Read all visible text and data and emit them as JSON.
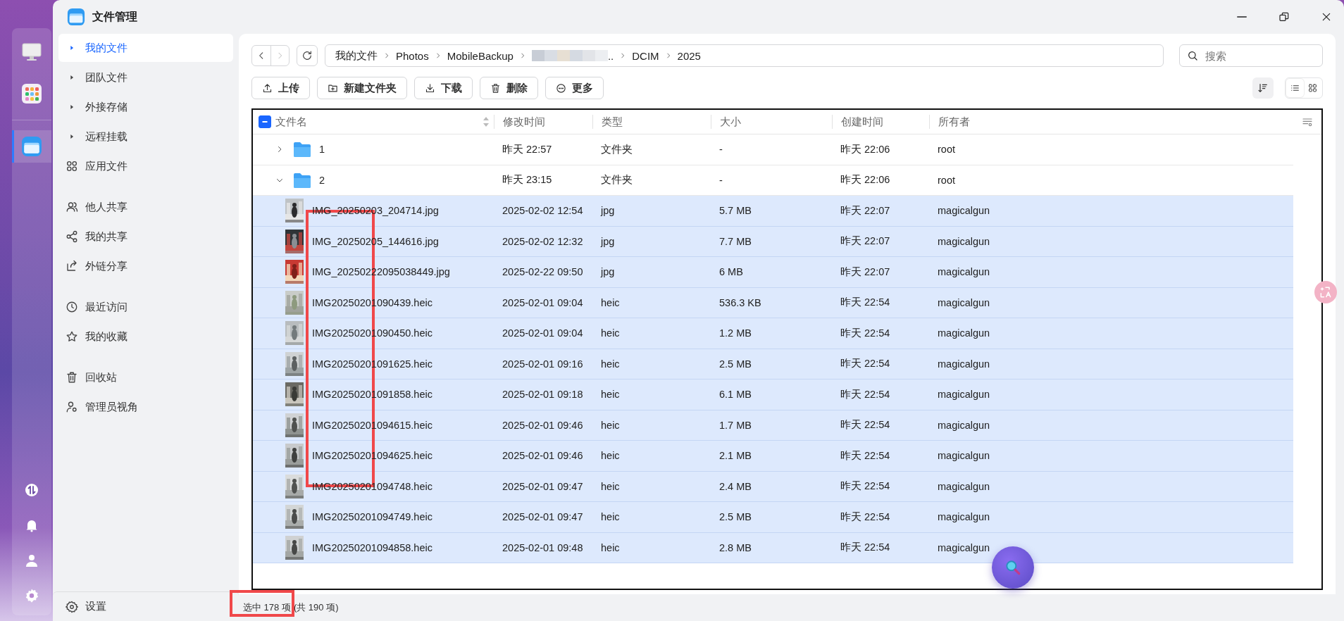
{
  "window": {
    "title": "文件管理"
  },
  "dock": [
    {
      "kind": "monitor",
      "selected": false
    },
    {
      "kind": "apps",
      "selected": false
    },
    {
      "kind": "files",
      "selected": true
    }
  ],
  "dock_bottom": [
    {
      "kind": "transfer"
    },
    {
      "kind": "bell"
    },
    {
      "kind": "user"
    },
    {
      "kind": "gear"
    }
  ],
  "sidebar": {
    "groups": [
      [
        {
          "label": "我的文件",
          "kind": "caret",
          "selected": true
        },
        {
          "label": "团队文件",
          "kind": "caret",
          "selected": false
        },
        {
          "label": "外接存储",
          "kind": "caret",
          "selected": false
        },
        {
          "label": "远程挂载",
          "kind": "caret",
          "selected": false
        },
        {
          "label": "应用文件",
          "kind": "apps",
          "selected": false
        }
      ],
      [
        {
          "label": "他人共享",
          "kind": "users",
          "selected": false
        },
        {
          "label": "我的共享",
          "kind": "share",
          "selected": false
        },
        {
          "label": "外链分享",
          "kind": "export",
          "selected": false
        }
      ],
      [
        {
          "label": "最近访问",
          "kind": "clock",
          "selected": false
        },
        {
          "label": "我的收藏",
          "kind": "star",
          "selected": false
        }
      ],
      [
        {
          "label": "回收站",
          "kind": "trash",
          "selected": false
        },
        {
          "label": "管理员视角",
          "kind": "admin",
          "selected": false
        }
      ]
    ],
    "settings": "设置"
  },
  "breadcrumb": [
    {
      "label": "我的文件",
      "kind": "text"
    },
    {
      "label": "Photos",
      "kind": "text"
    },
    {
      "label": "MobileBackup",
      "kind": "text"
    },
    {
      "label": "..",
      "kind": "blurred"
    },
    {
      "label": "DCIM",
      "kind": "text"
    },
    {
      "label": "2025",
      "kind": "text"
    }
  ],
  "search": {
    "placeholder": "搜索"
  },
  "toolbar": [
    {
      "label": "上传",
      "kind": "upload"
    },
    {
      "label": "新建文件夹",
      "kind": "folder"
    },
    {
      "label": "下载",
      "kind": "download"
    },
    {
      "label": "删除",
      "kind": "trash"
    },
    {
      "label": "更多",
      "kind": "more"
    }
  ],
  "view_mode": [
    {
      "kind": "list",
      "selected": true
    },
    {
      "kind": "grid",
      "selected": false
    }
  ],
  "table": {
    "select_all": {
      "partial": true
    },
    "columns": [
      "文件名",
      "修改时间",
      "类型",
      "大小",
      "创建时间",
      "所有者"
    ],
    "rows": [
      {
        "kind": "folder",
        "expanded": false,
        "selected": false,
        "name": "1",
        "modified": "昨天 22:57",
        "type": "文件夹",
        "size": "-",
        "created": "昨天 22:06",
        "owner": "root"
      },
      {
        "kind": "folder",
        "expanded": true,
        "selected": false,
        "name": "2",
        "modified": "昨天 23:15",
        "type": "文件夹",
        "size": "-",
        "created": "昨天 22:06",
        "owner": "root"
      },
      {
        "kind": "file",
        "selected": true,
        "name": "IMG_20250203_204714.jpg",
        "modified": "2025-02-02 12:54",
        "type": "jpg",
        "size": "5.7 MB",
        "created": "昨天 22:07",
        "owner": "magicalgun"
      },
      {
        "kind": "file",
        "selected": true,
        "name": "IMG_20250205_144616.jpg",
        "modified": "2025-02-02 12:32",
        "type": "jpg",
        "size": "7.7 MB",
        "created": "昨天 22:07",
        "owner": "magicalgun"
      },
      {
        "kind": "file",
        "selected": true,
        "name": "IMG_20250222095038449.jpg",
        "modified": "2025-02-22 09:50",
        "type": "jpg",
        "size": "6 MB",
        "created": "昨天 22:07",
        "owner": "magicalgun"
      },
      {
        "kind": "file",
        "selected": true,
        "name": "IMG20250201090439.heic",
        "modified": "2025-02-01 09:04",
        "type": "heic",
        "size": "536.3 KB",
        "created": "昨天 22:54",
        "owner": "magicalgun"
      },
      {
        "kind": "file",
        "selected": true,
        "name": "IMG20250201090450.heic",
        "modified": "2025-02-01 09:04",
        "type": "heic",
        "size": "1.2 MB",
        "created": "昨天 22:54",
        "owner": "magicalgun"
      },
      {
        "kind": "file",
        "selected": true,
        "name": "IMG20250201091625.heic",
        "modified": "2025-02-01 09:16",
        "type": "heic",
        "size": "2.5 MB",
        "created": "昨天 22:54",
        "owner": "magicalgun"
      },
      {
        "kind": "file",
        "selected": true,
        "name": "IMG20250201091858.heic",
        "modified": "2025-02-01 09:18",
        "type": "heic",
        "size": "6.1 MB",
        "created": "昨天 22:54",
        "owner": "magicalgun"
      },
      {
        "kind": "file",
        "selected": true,
        "name": "IMG20250201094615.heic",
        "modified": "2025-02-01 09:46",
        "type": "heic",
        "size": "1.7 MB",
        "created": "昨天 22:54",
        "owner": "magicalgun"
      },
      {
        "kind": "file",
        "selected": true,
        "name": "IMG20250201094625.heic",
        "modified": "2025-02-01 09:46",
        "type": "heic",
        "size": "2.1 MB",
        "created": "昨天 22:54",
        "owner": "magicalgun"
      },
      {
        "kind": "file",
        "selected": true,
        "name": "IMG20250201094748.heic",
        "modified": "2025-02-01 09:47",
        "type": "heic",
        "size": "2.4 MB",
        "created": "昨天 22:54",
        "owner": "magicalgun"
      },
      {
        "kind": "file",
        "selected": true,
        "name": "IMG20250201094749.heic",
        "modified": "2025-02-01 09:47",
        "type": "heic",
        "size": "2.5 MB",
        "created": "昨天 22:54",
        "owner": "magicalgun"
      },
      {
        "kind": "file",
        "selected": true,
        "name": "IMG20250201094858.heic",
        "modified": "2025-02-01 09:48",
        "type": "heic",
        "size": "2.8 MB",
        "created": "昨天 22:54",
        "owner": "magicalgun"
      }
    ]
  },
  "status": {
    "selected": "选中 178 项",
    "total": "(共 190 项)"
  },
  "annotations": [
    {
      "kind": "box"
    },
    {
      "kind": "box"
    }
  ]
}
